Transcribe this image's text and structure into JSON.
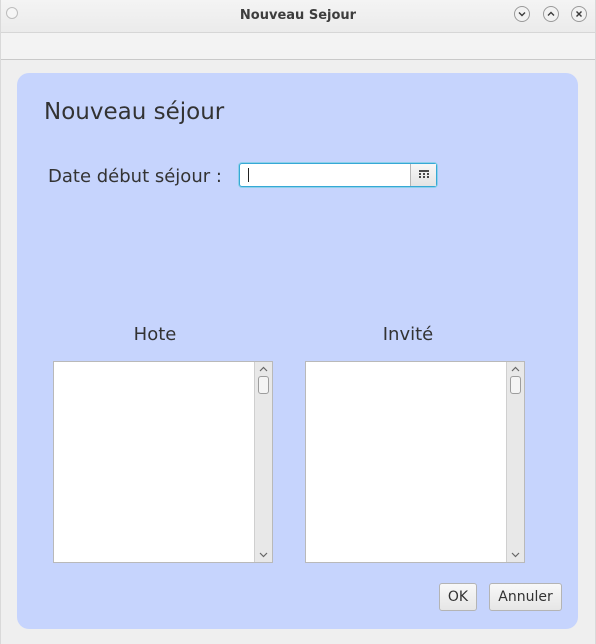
{
  "window": {
    "title": "Nouveau Sejour"
  },
  "dialog": {
    "heading": "Nouveau séjour",
    "date_label": "Date début séjour :",
    "date_value": "",
    "columns": {
      "hote_title": "Hote",
      "invite_title": "Invité"
    },
    "lists": {
      "hote_items": [],
      "invite_items": []
    },
    "buttons": {
      "ok_label": "OK",
      "cancel_label": "Annuler"
    }
  },
  "icons": {
    "window_dot": "circle-icon",
    "minimize": "chevron-down-icon",
    "maximize": "chevron-up-icon",
    "close": "close-icon",
    "calendar": "calendar-icon",
    "scroll_up": "arrow-up-icon",
    "scroll_down": "arrow-down-icon"
  },
  "colors": {
    "panel_background": "#c6d4fd",
    "focus_border": "#36a8d6"
  }
}
